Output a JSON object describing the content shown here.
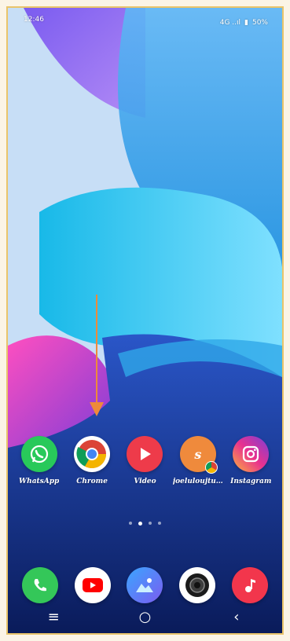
{
  "status_bar": {
    "time": "12:46",
    "signal_text": "4G ..ıl",
    "battery_text": "50%"
  },
  "home_apps": [
    {
      "name": "WhatsApp",
      "icon": "whatsapp-icon",
      "color": "#28c95a"
    },
    {
      "name": "Chrome",
      "icon": "chrome-icon",
      "color": "#ffffff"
    },
    {
      "name": "Video",
      "icon": "video-play-icon",
      "color": "#ee3b4a"
    },
    {
      "name": "joeluloujtu…",
      "icon": "app-letter-s-icon",
      "color": "#ef8a3c",
      "badge": "chrome-badge-icon"
    },
    {
      "name": "Instagram",
      "icon": "instagram-icon",
      "color": "#e8318f"
    }
  ],
  "page_indicator": {
    "pages": 4,
    "active": 1
  },
  "dock_apps": [
    {
      "name": "Phone",
      "icon": "phone-icon",
      "color": "#34c759"
    },
    {
      "name": "YouTube",
      "icon": "youtube-icon",
      "color": "#ffffff"
    },
    {
      "name": "Gallery",
      "icon": "gallery-icon",
      "color": "#3aa6ff"
    },
    {
      "name": "Camera",
      "icon": "camera-icon",
      "color": "#ffffff"
    },
    {
      "name": "Music",
      "icon": "music-icon",
      "color": "#f2364c"
    }
  ],
  "nav_bar": {
    "menu": "≡",
    "home": "○",
    "back": "‹"
  },
  "annotation": {
    "arrow_color": "#ee8a3a"
  }
}
